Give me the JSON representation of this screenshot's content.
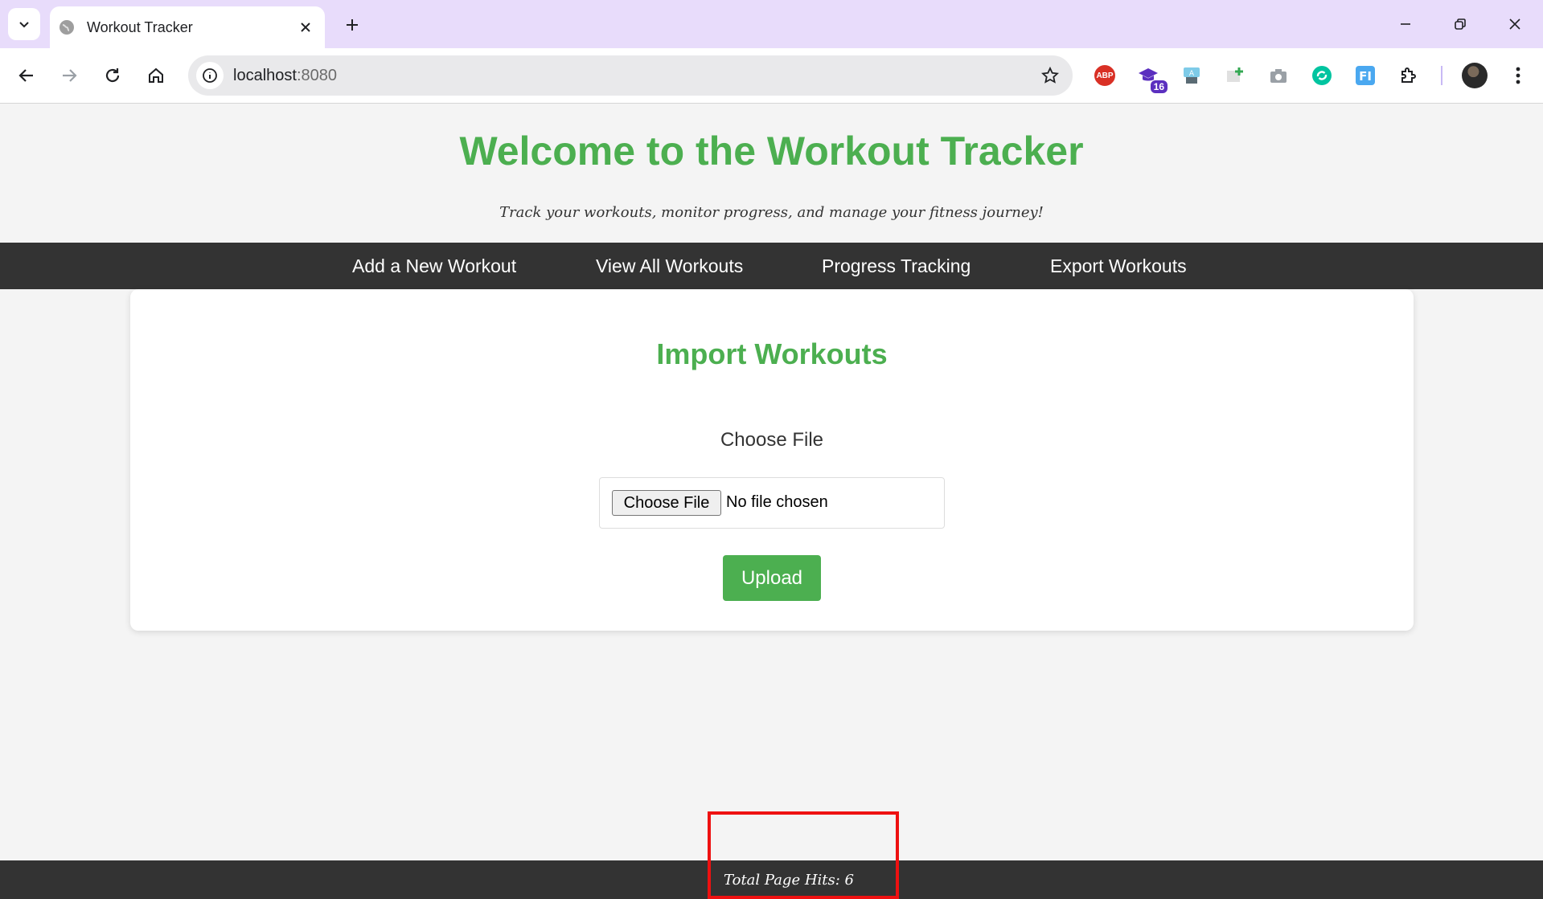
{
  "browser": {
    "tab_title": "Workout Tracker",
    "url_host": "localhost",
    "url_port": ":8080",
    "extensions": [
      {
        "name": "adblock-plus-icon",
        "label": "ABP"
      },
      {
        "name": "graduation-cap-icon",
        "badge": "16"
      },
      {
        "name": "translate-icon"
      },
      {
        "name": "add-note-icon"
      },
      {
        "name": "camera-icon"
      },
      {
        "name": "sync-icon"
      },
      {
        "name": "fi-icon",
        "label": "FI"
      },
      {
        "name": "extensions-puzzle-icon"
      }
    ],
    "tabstrip_color": "#e8dcfb"
  },
  "header": {
    "title": "Welcome to the Workout Tracker",
    "tagline": "Track your workouts, monitor progress, and manage your fitness journey!"
  },
  "nav": {
    "items": [
      {
        "label": "Add a New Workout"
      },
      {
        "label": "View All Workouts"
      },
      {
        "label": "Progress Tracking"
      },
      {
        "label": "Export Workouts"
      }
    ]
  },
  "import": {
    "title": "Import Workouts",
    "file_label": "Choose File",
    "choose_button": "Choose File",
    "no_file_text": "No file chosen",
    "upload_button": "Upload"
  },
  "footer": {
    "hits_text": "Total Page Hits: 6"
  },
  "colors": {
    "accent": "#4caf50",
    "nav_bg": "#333333",
    "page_bg": "#f4f4f4",
    "highlight": "#ee1111"
  }
}
